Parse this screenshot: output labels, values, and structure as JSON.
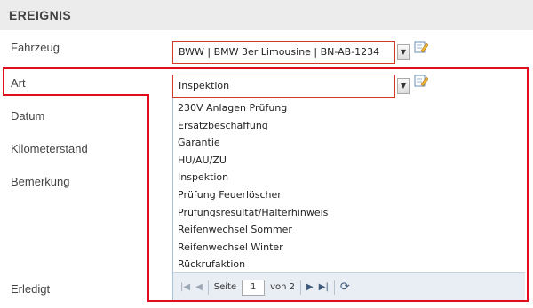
{
  "section": {
    "title": "EREIGNIS"
  },
  "form": {
    "labels": {
      "vehicle": "Fahrzeug",
      "type": "Art",
      "date": "Datum",
      "mileage": "Kilometerstand",
      "remark": "Bemerkung",
      "done": "Erledigt"
    },
    "vehicle": {
      "value": "BWW | BMW 3er Limousine | BN-AB-1234"
    },
    "type": {
      "value": "Inspektion"
    }
  },
  "dropdown": {
    "items": [
      "230V Anlagen Prüfung",
      "Ersatzbeschaffung",
      "Garantie",
      "HU/AU/ZU",
      "Inspektion",
      "Prüfung Feuerlöscher",
      "Prüfungsresultat/Halterhinweis",
      "Reifenwechsel Sommer",
      "Reifenwechsel Winter",
      "Rückrufaktion"
    ],
    "pager": {
      "page_label": "Seite",
      "page_value": "1",
      "of_label": "von 2"
    }
  },
  "colors": {
    "highlight": "#e10d1d",
    "field_border": "#d23b26",
    "header_bg": "#ececec"
  }
}
